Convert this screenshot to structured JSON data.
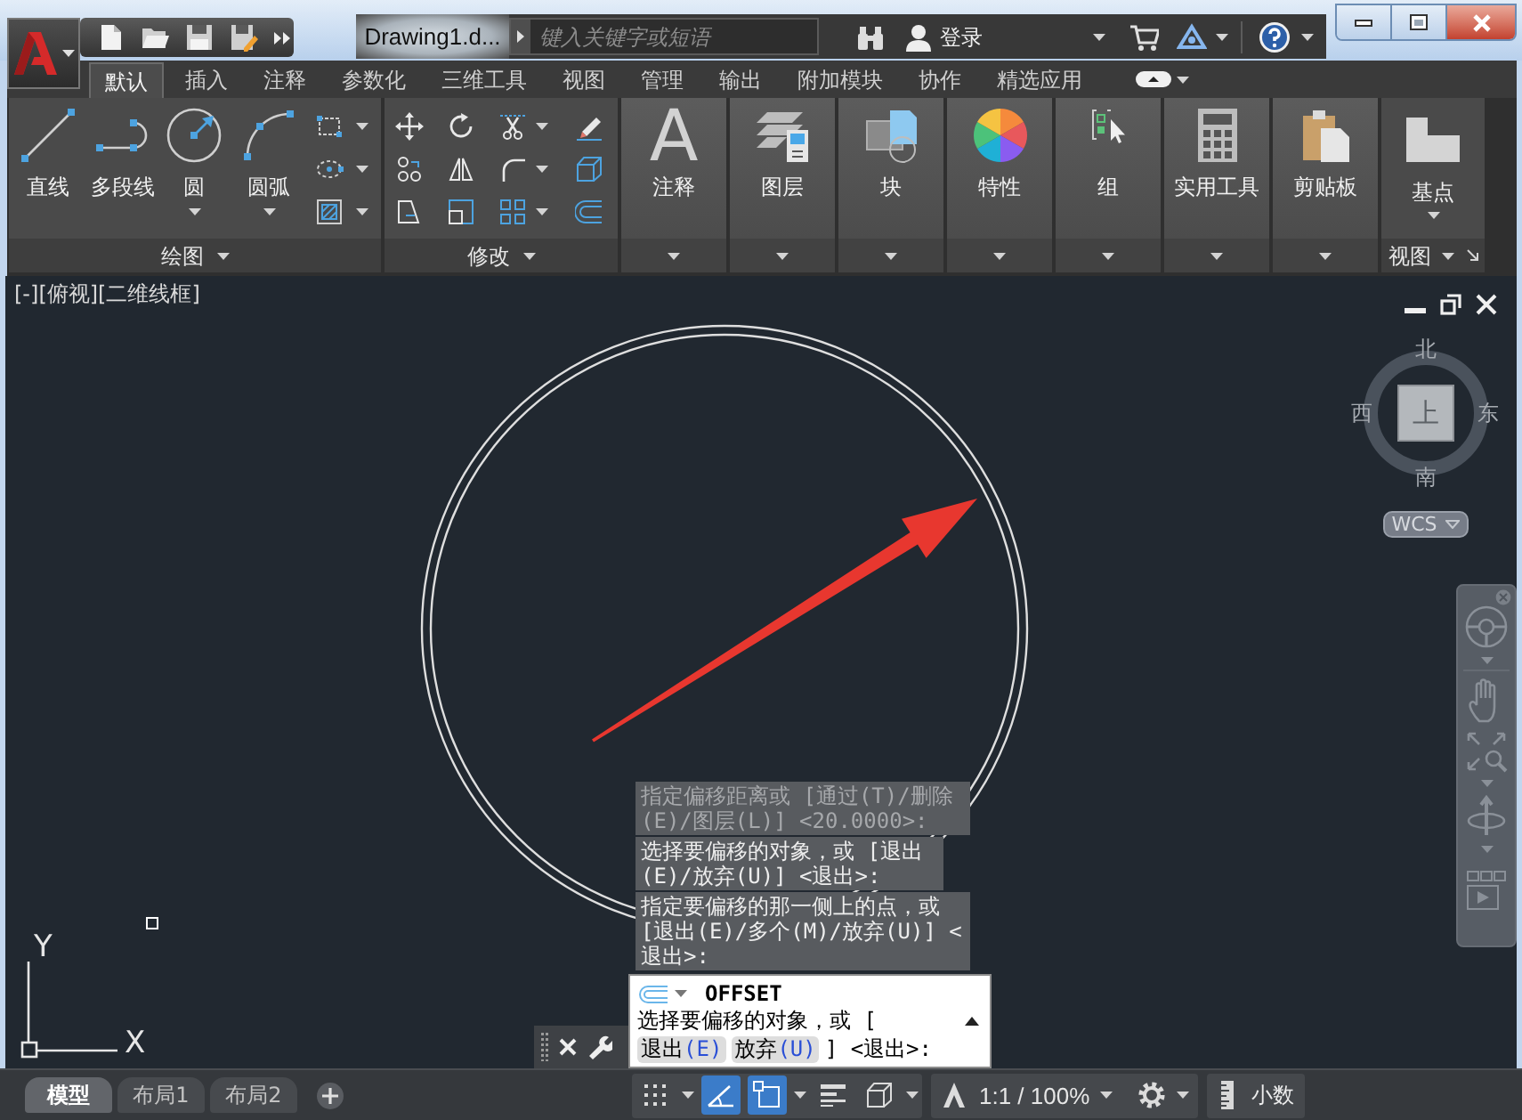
{
  "title_bar": {
    "document_title": "Drawing1.d...",
    "search": {
      "placeholder": "键入关键字或短语"
    },
    "sign_in": "登录"
  },
  "ribbon": {
    "tabs": [
      {
        "label": "默认",
        "selected": true
      },
      {
        "label": "插入",
        "selected": false
      },
      {
        "label": "注释",
        "selected": false
      },
      {
        "label": "参数化",
        "selected": false
      },
      {
        "label": "三维工具",
        "selected": false
      },
      {
        "label": "视图",
        "selected": false
      },
      {
        "label": "管理",
        "selected": false
      },
      {
        "label": "输出",
        "selected": false
      },
      {
        "label": "附加模块",
        "selected": false
      },
      {
        "label": "协作",
        "selected": false
      },
      {
        "label": "精选应用",
        "selected": false
      }
    ],
    "panels": [
      {
        "kind": "draw",
        "title": "绘图",
        "large_tools": [
          {
            "kind": "line",
            "label": "直线",
            "has_menu": false
          },
          {
            "kind": "polyline",
            "label": "多段线",
            "has_menu": false
          },
          {
            "kind": "circle",
            "label": "圆",
            "has_menu": true
          },
          {
            "kind": "arc",
            "label": "圆弧",
            "has_menu": true
          }
        ],
        "small_tools": [
          {
            "kind": "rectangle",
            "has_menu": true
          },
          {
            "kind": "ellipse",
            "has_menu": true
          },
          {
            "kind": "hatch",
            "has_menu": true
          }
        ]
      },
      {
        "kind": "modify",
        "title": "修改",
        "tools": [
          {
            "kind": "move",
            "has_menu": false
          },
          {
            "kind": "rotate",
            "has_menu": false
          },
          {
            "kind": "trim",
            "has_menu": true
          },
          {
            "kind": "erase",
            "has_menu": false
          },
          {
            "kind": "copy",
            "has_menu": false
          },
          {
            "kind": "mirror",
            "has_menu": false
          },
          {
            "kind": "fillet",
            "has_menu": true
          },
          {
            "kind": "explode",
            "has_menu": false
          },
          {
            "kind": "stretch",
            "has_menu": false
          },
          {
            "kind": "scale",
            "has_menu": false
          },
          {
            "kind": "array",
            "has_menu": true
          },
          {
            "kind": "offset",
            "has_menu": false
          }
        ]
      },
      {
        "kind": "annotation",
        "glyph": "A",
        "label": "注释"
      },
      {
        "kind": "layers",
        "label": "图层"
      },
      {
        "kind": "block",
        "label": "块"
      },
      {
        "kind": "properties",
        "label": "特性"
      },
      {
        "kind": "group",
        "label": "组"
      },
      {
        "kind": "utilities",
        "label": "实用工具"
      },
      {
        "kind": "clipboard",
        "label": "剪贴板"
      },
      {
        "kind": "view",
        "title": "视图",
        "tools": [
          {
            "kind": "base_point",
            "label": "基点",
            "has_menu": true
          }
        ]
      }
    ]
  },
  "viewport": {
    "label": "[-][俯视][二维线框]",
    "viewcube": {
      "north": "北",
      "west": "西",
      "top": "上",
      "east": "东",
      "south": "南"
    },
    "ucs_menu": "WCS",
    "axes": {
      "y": "Y",
      "x": "X"
    }
  },
  "command_history": [
    {
      "text": "指定偏移距离或 [通过(T)/删除(E)/图层(L)] <20.0000>:",
      "faded": true
    },
    {
      "text": "选择要偏移的对象，或 [退出(E)/放弃(U)] <退出>:",
      "faded": false
    },
    {
      "text": "指定要偏移的那一侧上的点，或 [退出(E)/多个(M)/放弃(U)] <退出>:",
      "faded": false
    }
  ],
  "command_line": {
    "command": "OFFSET",
    "prompt": "选择要偏移的对象，或 [",
    "options": [
      {
        "label": "退出",
        "key": "(E)"
      },
      {
        "label": "放弃",
        "key": "(U)"
      }
    ],
    "suffix": "] <退出>:"
  },
  "status_bar": {
    "layout_tabs": [
      {
        "label": "模型",
        "selected": true
      },
      {
        "label": "布局1",
        "selected": false
      },
      {
        "label": "布局2",
        "selected": false
      }
    ],
    "toggles": [
      {
        "kind": "grid",
        "on": false,
        "has_menu": true
      },
      {
        "kind": "polar",
        "on": true,
        "has_menu": false
      },
      {
        "kind": "snap",
        "on": true,
        "has_menu": true
      },
      {
        "kind": "lineweight",
        "on": false,
        "has_menu": false
      },
      {
        "kind": "isometric",
        "on": false,
        "has_menu": true
      }
    ],
    "scale": "1:1 / 100%",
    "units": "小数"
  }
}
